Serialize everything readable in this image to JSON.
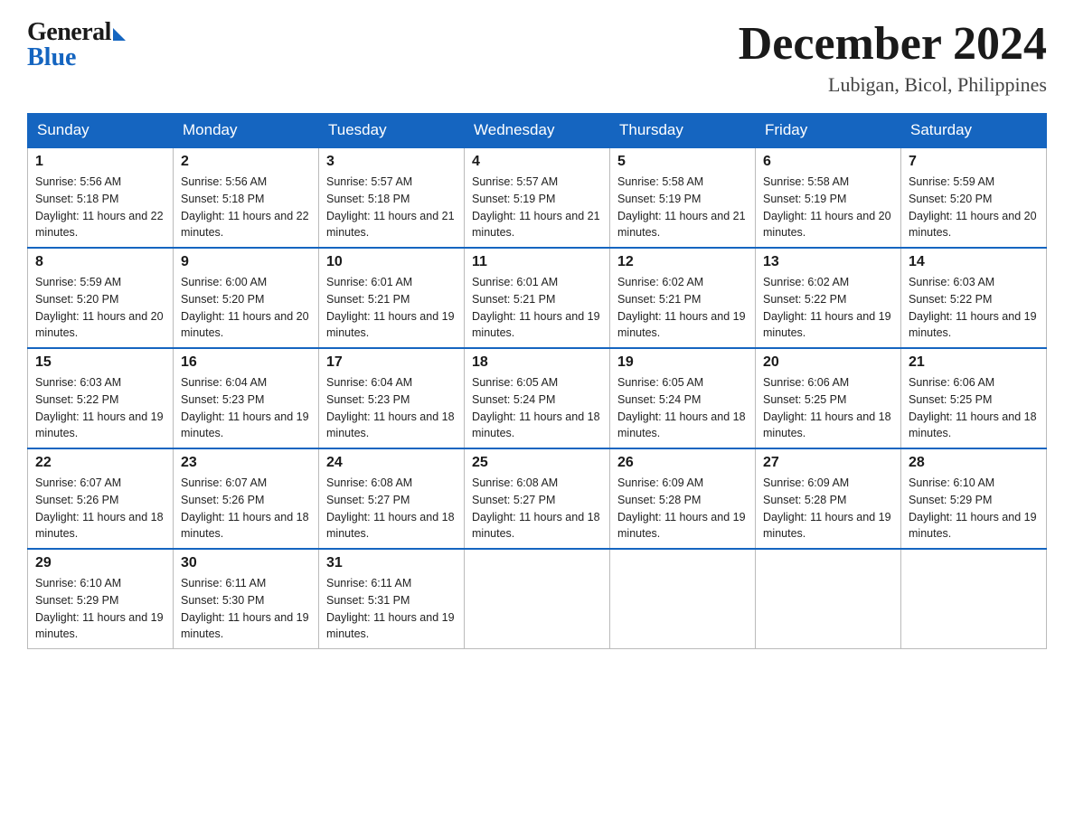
{
  "logo": {
    "general": "General",
    "blue": "Blue"
  },
  "title": {
    "month_year": "December 2024",
    "location": "Lubigan, Bicol, Philippines"
  },
  "header_days": [
    "Sunday",
    "Monday",
    "Tuesday",
    "Wednesday",
    "Thursday",
    "Friday",
    "Saturday"
  ],
  "weeks": [
    [
      {
        "day": "1",
        "sunrise": "Sunrise: 5:56 AM",
        "sunset": "Sunset: 5:18 PM",
        "daylight": "Daylight: 11 hours and 22 minutes."
      },
      {
        "day": "2",
        "sunrise": "Sunrise: 5:56 AM",
        "sunset": "Sunset: 5:18 PM",
        "daylight": "Daylight: 11 hours and 22 minutes."
      },
      {
        "day": "3",
        "sunrise": "Sunrise: 5:57 AM",
        "sunset": "Sunset: 5:18 PM",
        "daylight": "Daylight: 11 hours and 21 minutes."
      },
      {
        "day": "4",
        "sunrise": "Sunrise: 5:57 AM",
        "sunset": "Sunset: 5:19 PM",
        "daylight": "Daylight: 11 hours and 21 minutes."
      },
      {
        "day": "5",
        "sunrise": "Sunrise: 5:58 AM",
        "sunset": "Sunset: 5:19 PM",
        "daylight": "Daylight: 11 hours and 21 minutes."
      },
      {
        "day": "6",
        "sunrise": "Sunrise: 5:58 AM",
        "sunset": "Sunset: 5:19 PM",
        "daylight": "Daylight: 11 hours and 20 minutes."
      },
      {
        "day": "7",
        "sunrise": "Sunrise: 5:59 AM",
        "sunset": "Sunset: 5:20 PM",
        "daylight": "Daylight: 11 hours and 20 minutes."
      }
    ],
    [
      {
        "day": "8",
        "sunrise": "Sunrise: 5:59 AM",
        "sunset": "Sunset: 5:20 PM",
        "daylight": "Daylight: 11 hours and 20 minutes."
      },
      {
        "day": "9",
        "sunrise": "Sunrise: 6:00 AM",
        "sunset": "Sunset: 5:20 PM",
        "daylight": "Daylight: 11 hours and 20 minutes."
      },
      {
        "day": "10",
        "sunrise": "Sunrise: 6:01 AM",
        "sunset": "Sunset: 5:21 PM",
        "daylight": "Daylight: 11 hours and 19 minutes."
      },
      {
        "day": "11",
        "sunrise": "Sunrise: 6:01 AM",
        "sunset": "Sunset: 5:21 PM",
        "daylight": "Daylight: 11 hours and 19 minutes."
      },
      {
        "day": "12",
        "sunrise": "Sunrise: 6:02 AM",
        "sunset": "Sunset: 5:21 PM",
        "daylight": "Daylight: 11 hours and 19 minutes."
      },
      {
        "day": "13",
        "sunrise": "Sunrise: 6:02 AM",
        "sunset": "Sunset: 5:22 PM",
        "daylight": "Daylight: 11 hours and 19 minutes."
      },
      {
        "day": "14",
        "sunrise": "Sunrise: 6:03 AM",
        "sunset": "Sunset: 5:22 PM",
        "daylight": "Daylight: 11 hours and 19 minutes."
      }
    ],
    [
      {
        "day": "15",
        "sunrise": "Sunrise: 6:03 AM",
        "sunset": "Sunset: 5:22 PM",
        "daylight": "Daylight: 11 hours and 19 minutes."
      },
      {
        "day": "16",
        "sunrise": "Sunrise: 6:04 AM",
        "sunset": "Sunset: 5:23 PM",
        "daylight": "Daylight: 11 hours and 19 minutes."
      },
      {
        "day": "17",
        "sunrise": "Sunrise: 6:04 AM",
        "sunset": "Sunset: 5:23 PM",
        "daylight": "Daylight: 11 hours and 18 minutes."
      },
      {
        "day": "18",
        "sunrise": "Sunrise: 6:05 AM",
        "sunset": "Sunset: 5:24 PM",
        "daylight": "Daylight: 11 hours and 18 minutes."
      },
      {
        "day": "19",
        "sunrise": "Sunrise: 6:05 AM",
        "sunset": "Sunset: 5:24 PM",
        "daylight": "Daylight: 11 hours and 18 minutes."
      },
      {
        "day": "20",
        "sunrise": "Sunrise: 6:06 AM",
        "sunset": "Sunset: 5:25 PM",
        "daylight": "Daylight: 11 hours and 18 minutes."
      },
      {
        "day": "21",
        "sunrise": "Sunrise: 6:06 AM",
        "sunset": "Sunset: 5:25 PM",
        "daylight": "Daylight: 11 hours and 18 minutes."
      }
    ],
    [
      {
        "day": "22",
        "sunrise": "Sunrise: 6:07 AM",
        "sunset": "Sunset: 5:26 PM",
        "daylight": "Daylight: 11 hours and 18 minutes."
      },
      {
        "day": "23",
        "sunrise": "Sunrise: 6:07 AM",
        "sunset": "Sunset: 5:26 PM",
        "daylight": "Daylight: 11 hours and 18 minutes."
      },
      {
        "day": "24",
        "sunrise": "Sunrise: 6:08 AM",
        "sunset": "Sunset: 5:27 PM",
        "daylight": "Daylight: 11 hours and 18 minutes."
      },
      {
        "day": "25",
        "sunrise": "Sunrise: 6:08 AM",
        "sunset": "Sunset: 5:27 PM",
        "daylight": "Daylight: 11 hours and 18 minutes."
      },
      {
        "day": "26",
        "sunrise": "Sunrise: 6:09 AM",
        "sunset": "Sunset: 5:28 PM",
        "daylight": "Daylight: 11 hours and 19 minutes."
      },
      {
        "day": "27",
        "sunrise": "Sunrise: 6:09 AM",
        "sunset": "Sunset: 5:28 PM",
        "daylight": "Daylight: 11 hours and 19 minutes."
      },
      {
        "day": "28",
        "sunrise": "Sunrise: 6:10 AM",
        "sunset": "Sunset: 5:29 PM",
        "daylight": "Daylight: 11 hours and 19 minutes."
      }
    ],
    [
      {
        "day": "29",
        "sunrise": "Sunrise: 6:10 AM",
        "sunset": "Sunset: 5:29 PM",
        "daylight": "Daylight: 11 hours and 19 minutes."
      },
      {
        "day": "30",
        "sunrise": "Sunrise: 6:11 AM",
        "sunset": "Sunset: 5:30 PM",
        "daylight": "Daylight: 11 hours and 19 minutes."
      },
      {
        "day": "31",
        "sunrise": "Sunrise: 6:11 AM",
        "sunset": "Sunset: 5:31 PM",
        "daylight": "Daylight: 11 hours and 19 minutes."
      },
      null,
      null,
      null,
      null
    ]
  ]
}
